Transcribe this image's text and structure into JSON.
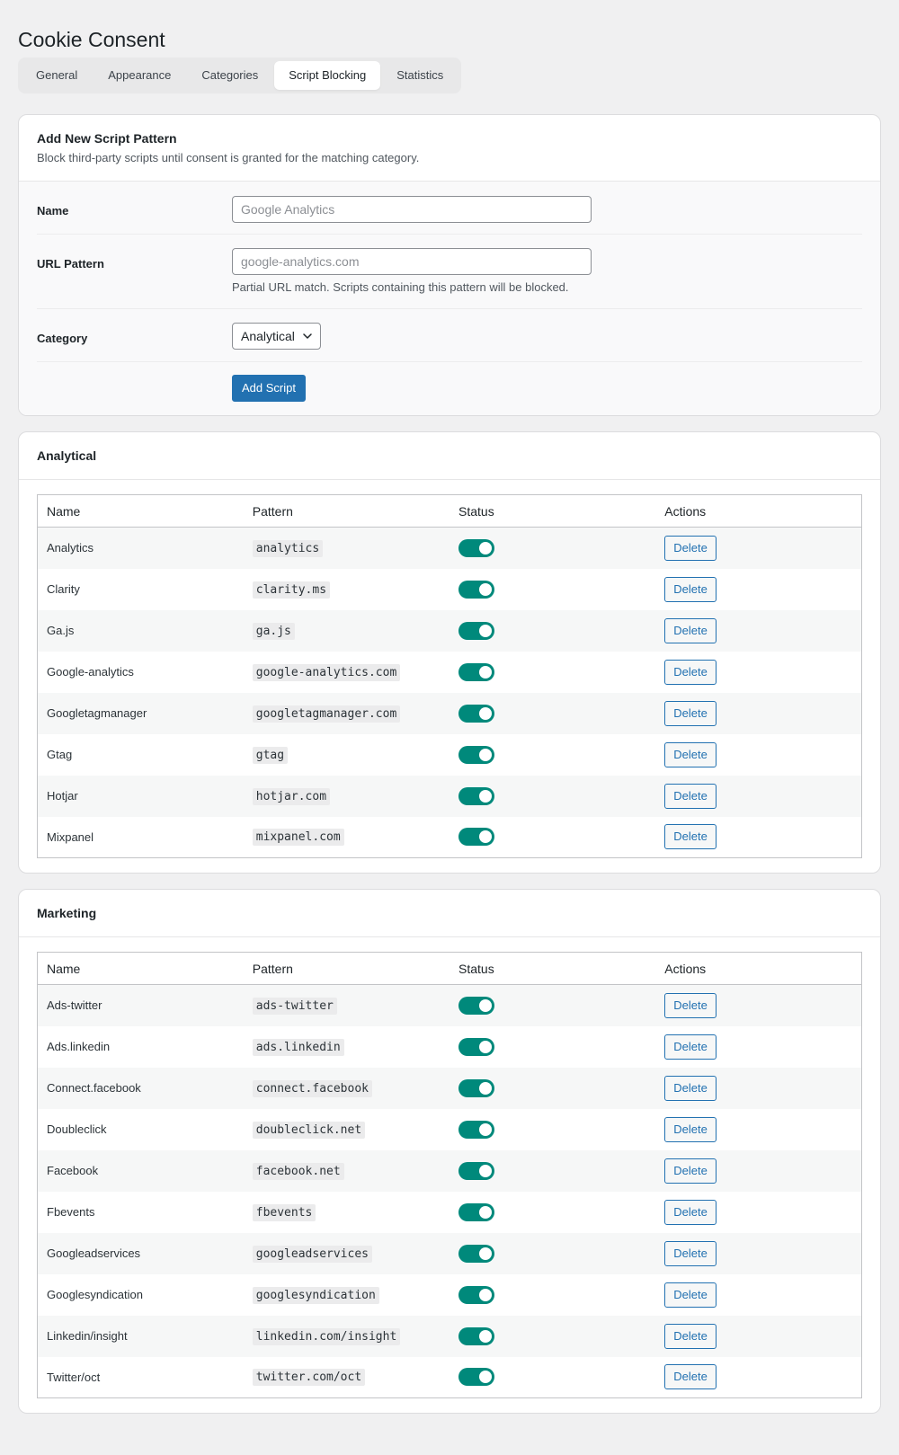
{
  "page": {
    "title": "Cookie Consent"
  },
  "tabs": [
    {
      "label": "General",
      "active": false
    },
    {
      "label": "Appearance",
      "active": false
    },
    {
      "label": "Categories",
      "active": false
    },
    {
      "label": "Script Blocking",
      "active": true
    },
    {
      "label": "Statistics",
      "active": false
    }
  ],
  "add_form": {
    "title": "Add New Script Pattern",
    "description": "Block third-party scripts until consent is granted for the matching category.",
    "name_label": "Name",
    "name_placeholder": "Google Analytics",
    "name_value": "",
    "url_label": "URL Pattern",
    "url_placeholder": "google-analytics.com",
    "url_value": "",
    "url_help": "Partial URL match. Scripts containing this pattern will be blocked.",
    "category_label": "Category",
    "category_selected": "Analytical",
    "submit_label": "Add Script"
  },
  "columns": {
    "name": "Name",
    "pattern": "Pattern",
    "status": "Status",
    "actions": "Actions"
  },
  "delete_label": "Delete",
  "colors": {
    "primary": "#2271b1",
    "toggle_on": "#00897b"
  },
  "icons": {
    "select": "chevron-down-icon"
  },
  "groups": [
    {
      "title": "Analytical",
      "rows": [
        {
          "name": "Analytics",
          "pattern": "analytics",
          "enabled": true
        },
        {
          "name": "Clarity",
          "pattern": "clarity.ms",
          "enabled": true
        },
        {
          "name": "Ga.js",
          "pattern": "ga.js",
          "enabled": true
        },
        {
          "name": "Google-analytics",
          "pattern": "google-analytics.com",
          "enabled": true
        },
        {
          "name": "Googletagmanager",
          "pattern": "googletagmanager.com",
          "enabled": true
        },
        {
          "name": "Gtag",
          "pattern": "gtag",
          "enabled": true
        },
        {
          "name": "Hotjar",
          "pattern": "hotjar.com",
          "enabled": true
        },
        {
          "name": "Mixpanel",
          "pattern": "mixpanel.com",
          "enabled": true
        }
      ]
    },
    {
      "title": "Marketing",
      "rows": [
        {
          "name": "Ads-twitter",
          "pattern": "ads-twitter",
          "enabled": true
        },
        {
          "name": "Ads.linkedin",
          "pattern": "ads.linkedin",
          "enabled": true
        },
        {
          "name": "Connect.facebook",
          "pattern": "connect.facebook",
          "enabled": true
        },
        {
          "name": "Doubleclick",
          "pattern": "doubleclick.net",
          "enabled": true
        },
        {
          "name": "Facebook",
          "pattern": "facebook.net",
          "enabled": true
        },
        {
          "name": "Fbevents",
          "pattern": "fbevents",
          "enabled": true
        },
        {
          "name": "Googleadservices",
          "pattern": "googleadservices",
          "enabled": true
        },
        {
          "name": "Googlesyndication",
          "pattern": "googlesyndication",
          "enabled": true
        },
        {
          "name": "Linkedin/insight",
          "pattern": "linkedin.com/insight",
          "enabled": true
        },
        {
          "name": "Twitter/oct",
          "pattern": "twitter.com/oct",
          "enabled": true
        }
      ]
    }
  ]
}
